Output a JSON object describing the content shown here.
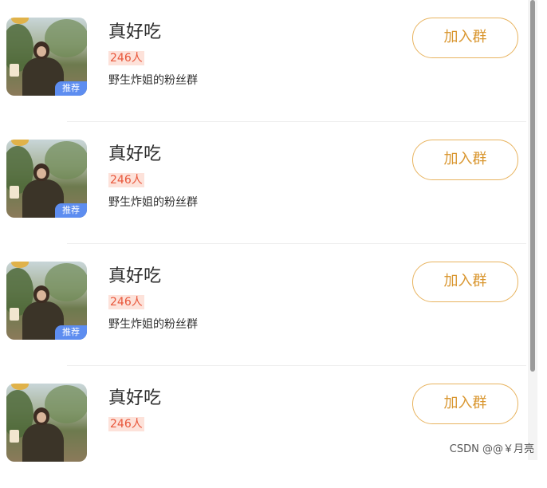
{
  "groups": [
    {
      "title": "真好吃",
      "count": "246人",
      "desc": "野生炸姐的粉丝群",
      "badge": "推荐",
      "button": "加入群"
    },
    {
      "title": "真好吃",
      "count": "246人",
      "desc": "野生炸姐的粉丝群",
      "badge": "推荐",
      "button": "加入群"
    },
    {
      "title": "真好吃",
      "count": "246人",
      "desc": "野生炸姐的粉丝群",
      "badge": "推荐",
      "button": "加入群"
    },
    {
      "title": "真好吃",
      "count": "246人",
      "desc": "",
      "badge": "",
      "button": "加入群"
    }
  ],
  "watermark": "CSDN @@￥月亮",
  "colors": {
    "accent": "#e8b460",
    "badge": "#5d8df0",
    "count": "#e8563a"
  }
}
